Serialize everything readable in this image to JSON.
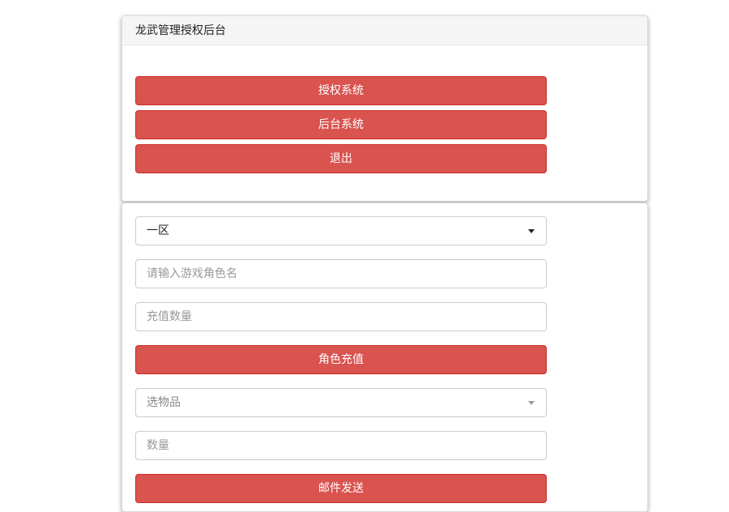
{
  "header": {
    "title": "龙武管理授权后台"
  },
  "menu": {
    "auth_system_label": "授权系统",
    "backend_system_label": "后台系统",
    "logout_label": "退出"
  },
  "recharge_form": {
    "server_select": {
      "selected": "一区"
    },
    "character_name": {
      "placeholder": "请输入游戏角色名"
    },
    "amount": {
      "placeholder": "充值数量"
    },
    "recharge_button_label": "角色充值",
    "item_select": {
      "placeholder": "选物品"
    },
    "quantity": {
      "placeholder": "数量"
    },
    "send_mail_button_label": "邮件发送"
  },
  "colors": {
    "button_red": "#d9534f",
    "panel_heading_bg": "#f5f5f5",
    "border": "#cccccc"
  },
  "icons": {
    "server_select_caret": "caret-down-icon",
    "item_select_caret": "caret-down-icon"
  }
}
